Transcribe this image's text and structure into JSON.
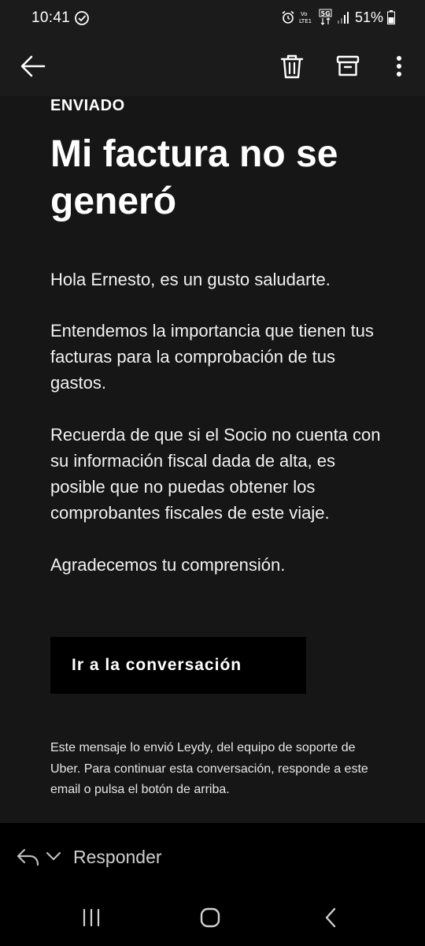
{
  "status_bar": {
    "time": "10:41",
    "battery_percent": "51%",
    "network_label": "5G",
    "volte_label": "Vo LTE1"
  },
  "app_bar": {
    "back_icon": "arrow-left-icon",
    "delete_icon": "trash-icon",
    "archive_icon": "archive-icon",
    "more_icon": "more-vertical-icon"
  },
  "email": {
    "status_label": "ENVIADO",
    "subject": "Mi factura no se generó",
    "paragraphs": [
      "Hola Ernesto, es un gusto saludarte.",
      "Entendemos la importancia que tienen tus facturas para la comprobación de tus gastos.",
      "Recuerda de que si el Socio no cuenta con su información fiscal dada de alta, es posible que no puedas obtener los comprobantes fiscales de este viaje.",
      "Agradecemos tu comprensión."
    ],
    "cta_label": "Ir a la conversación",
    "footer_note": "Este mensaje lo envió Leydy, del equipo de soporte de Uber. Para continuar esta conversación, responde a este email o pulsa el botón de arriba."
  },
  "reply_bar": {
    "label": "Responder"
  },
  "colors": {
    "background": "#000000",
    "surface": "#161616",
    "app_bar": "#1b1b1b",
    "text": "#ffffff",
    "muted_text": "#cfcfcf"
  }
}
